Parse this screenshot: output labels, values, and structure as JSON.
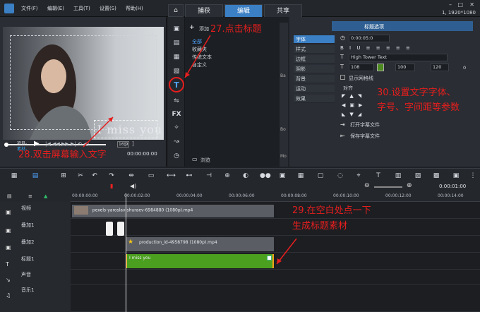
{
  "menu": [
    "文件(F)",
    "编辑(E)",
    "工具(T)",
    "设置(S)",
    "帮助(H)"
  ],
  "tabs": [
    "捕获",
    "编辑",
    "共享"
  ],
  "resolution": "1, 1920*1080",
  "preview": {
    "title_text": "I miss you",
    "project_label": "项目-",
    "clip_label": "素材-",
    "timecode": "00:00:00:00",
    "ratio": "16:9"
  },
  "library": {
    "add_label": "添加",
    "items": [
      "全部",
      "收藏夹",
      "传统文本",
      "自定义"
    ],
    "browse_label": "浏览"
  },
  "options": {
    "header": "标题选项",
    "tabs": [
      "字体",
      "样式",
      "边框",
      "阴影",
      "背景",
      "运动",
      "效果"
    ],
    "duration": "0:00:05:0",
    "font_name": "High Tower Text",
    "font_size": "108",
    "spacing": "100",
    "angle": "120",
    "angle2": "0",
    "grid_label": "显示网格线",
    "align_label": "对齐",
    "open_file": "打开字幕文件",
    "save_file": "保存字幕文件",
    "side_letters": [
      "Ba",
      "Bo",
      "Mo"
    ]
  },
  "timeline": {
    "zoom_time": "0:00:01:00",
    "ticks": [
      "00:00:00:00",
      "00:00:02:00",
      "00:00:04:00",
      "00:00:06:00",
      "00:00:08:00",
      "00:00:10:00",
      "00:00:12:00",
      "00:00:14:00"
    ],
    "tracks": [
      "视频",
      "叠加1",
      "叠加2",
      "标题1",
      "声音",
      "音乐1"
    ],
    "clips": {
      "video": "pexels-yaroslav-shuraev-6984880 (1080p).mp4",
      "overlay2": "production_id-4958798 (1080p).mp4",
      "title": "I miss you"
    }
  },
  "annotations": {
    "a27": "27.点击标题",
    "a28": "28.双击屏幕输入文字",
    "a29_line1": "29.在空白处点一下",
    "a29_line2": "生成标题素材",
    "a30_line1": "30.设置文字字体、",
    "a30_line2": "字号、字间距等参数"
  }
}
